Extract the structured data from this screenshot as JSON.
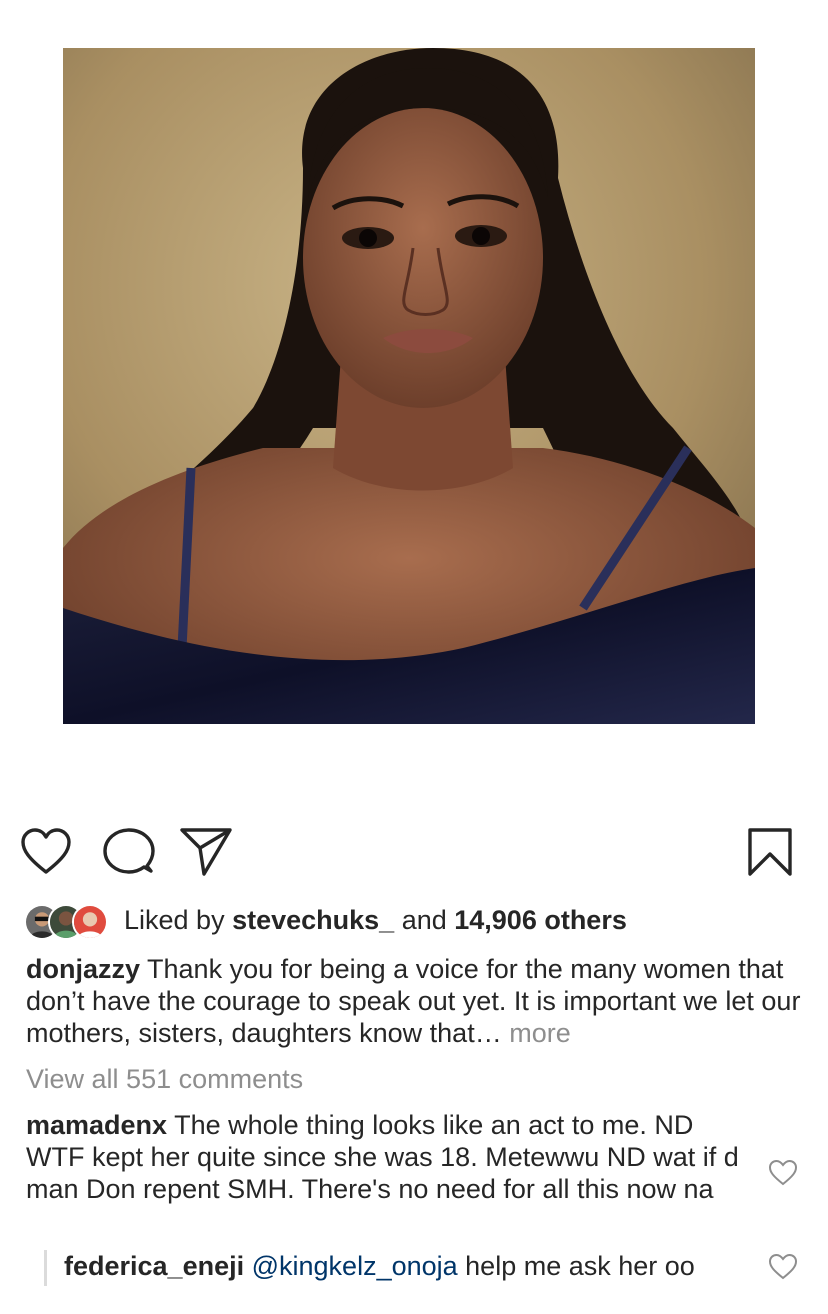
{
  "post": {
    "image_alt": "Portrait of a woman in a dark velvet off-shoulder top",
    "icons": {
      "like": "heart-icon",
      "comment": "comment-bubble-icon",
      "share": "paper-plane-icon",
      "save": "bookmark-icon",
      "comment_like": "heart-outline-icon"
    },
    "colors": {
      "text": "#262626",
      "muted": "#8e8e8e",
      "mention": "#003569",
      "divider": "#dbdbdb"
    }
  },
  "likes": {
    "prefix": "Liked by ",
    "user": "stevechuks_",
    "middle": " and ",
    "count": "14,906 others"
  },
  "caption": {
    "username": "donjazzy",
    "text": " Thank you for being a voice for the many women that don’t have the courage to speak out yet. It is important we let our mothers, sisters, daughters know that…",
    "more": " more"
  },
  "view_all_comments": "View all 551 comments",
  "comments": [
    {
      "username": "mamadenx",
      "text": " The whole thing looks like an act to me. ND WTF kept her quite since she was 18. Metewwu ND wat if d man Don repent SMH. There's no need for all this now na"
    },
    {
      "username": "federica_eneji",
      "mention": " @kingkelz_onoja",
      "text": " help me ask her oo"
    }
  ]
}
